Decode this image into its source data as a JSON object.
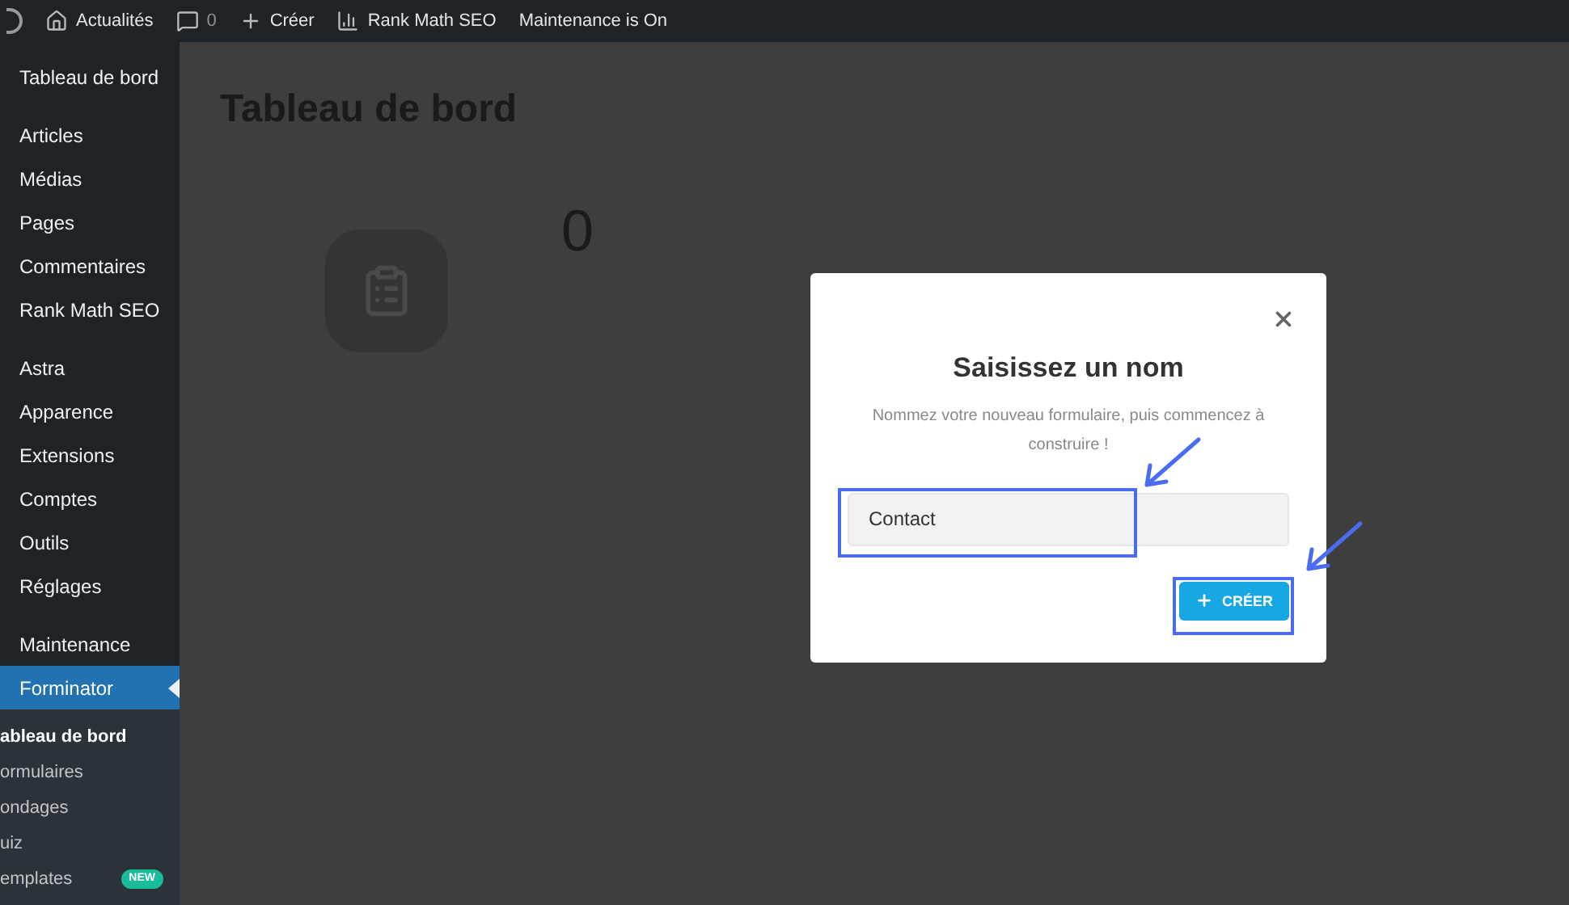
{
  "top_bar": {
    "items": [
      {
        "kind": "home",
        "label": "Actualités"
      },
      {
        "kind": "comments",
        "label": "0"
      },
      {
        "kind": "new",
        "label": "Créer"
      },
      {
        "kind": "chart",
        "label": "Rank Math SEO"
      },
      {
        "kind": "text",
        "label": "Maintenance is On"
      }
    ]
  },
  "sidebar": {
    "groups": [
      [
        {
          "label": "Tableau de bord",
          "selected": false
        }
      ],
      [
        {
          "label": "Articles",
          "selected": false
        },
        {
          "label": "Médias",
          "selected": false
        },
        {
          "label": "Pages",
          "selected": false
        },
        {
          "label": "Commentaires",
          "selected": false
        },
        {
          "label": "Rank Math SEO",
          "selected": false
        }
      ],
      [
        {
          "label": "Astra",
          "selected": false
        },
        {
          "label": "Apparence",
          "selected": false
        },
        {
          "label": "Extensions",
          "selected": false
        },
        {
          "label": "Comptes",
          "selected": false
        },
        {
          "label": "Outils",
          "selected": false
        },
        {
          "label": "Réglages",
          "selected": false
        }
      ],
      [
        {
          "label": "Maintenance",
          "selected": false
        },
        {
          "label": "Forminator",
          "selected": true,
          "children": [
            {
              "label": "ableau de bord",
              "selected": true
            },
            {
              "label": "ormulaires",
              "selected": false
            },
            {
              "label": "ondages",
              "selected": false
            },
            {
              "label": "uiz",
              "selected": false
            },
            {
              "label": "emplates",
              "selected": false,
              "badge": "NEW"
            }
          ]
        }
      ]
    ]
  },
  "page": {
    "title": "Tableau de bord",
    "count": "0"
  },
  "modal": {
    "title": "Saisissez un nom",
    "description": "Nommez votre nouveau formulaire, puis commencez à construire !",
    "input_value": "Contact",
    "button": "CRÉER"
  }
}
